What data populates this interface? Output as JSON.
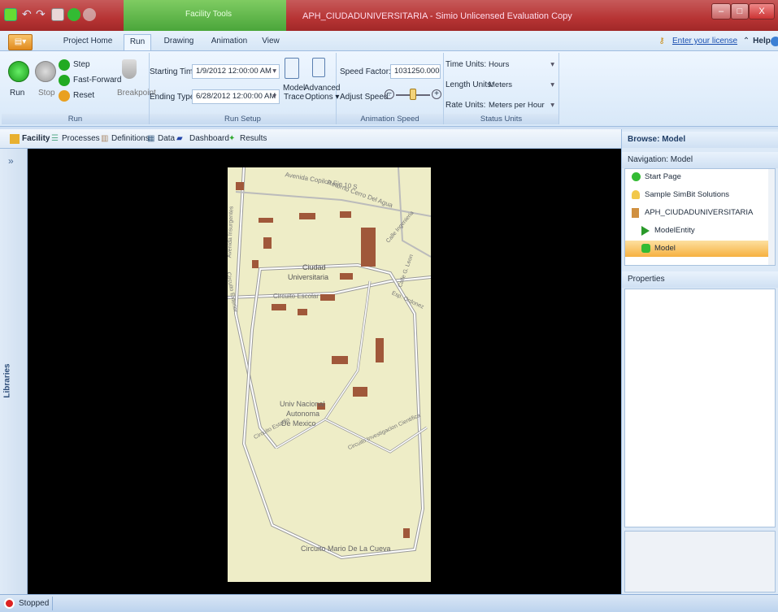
{
  "window": {
    "title": "APH_CIUDADUNIVERSITARIA - Simio Unlicensed Evaluation Copy",
    "context_tab": "Facility Tools"
  },
  "ribbon_tabs": [
    "Project Home",
    "Run",
    "Drawing",
    "Animation",
    "View"
  ],
  "license_link": "Enter your license key...",
  "help_label": "Help",
  "run_group": {
    "run": "Run",
    "stop": "Stop",
    "step": "Step",
    "fast_forward": "Fast-Forward",
    "reset": "Reset",
    "breakpoint": "Breakpoint",
    "label": "Run"
  },
  "run_setup": {
    "starting_time_label": "Starting Time:",
    "starting_time": "1/9/2012 12:00:00 AM",
    "ending_type_label": "Ending Type:",
    "ending_type": "6/28/2012 12:00:00 AM",
    "model_trace_1": "Model",
    "model_trace_2": "Trace",
    "advanced_1": "Advanced",
    "advanced_2": "Options ▾",
    "label": "Run Setup"
  },
  "animation_speed": {
    "speed_factor_label": "Speed Factor:",
    "speed_factor": "1031250.000",
    "adjust_speed_label": "Adjust Speed:",
    "adjust_speed_level": 0.5,
    "label": "Animation Speed"
  },
  "status_units": {
    "time_units_label": "Time Units:",
    "time_units": "Hours",
    "length_units_label": "Length Units:",
    "length_units": "Meters",
    "rate_units_label": "Rate Units:",
    "rate_units": "Meters per Hour",
    "label": "Status Units"
  },
  "view_tabs": [
    "Facility",
    "Processes",
    "Definitions",
    "Data",
    "Dashboard",
    "Results"
  ],
  "libraries_label": "Libraries",
  "map_labels": {
    "copilco": "Avenida Copilco Eje 10 S",
    "retorno": "Retorno Cerro Del Agua",
    "ingenieria": "Calle Ingenieria",
    "insurgentes": "Avenida Insurgentes",
    "ciudad": "Ciudad",
    "universitaria": "Universitaria",
    "escolar": "Circuito Escolar",
    "exterior": "Circuito Exterior",
    "leon": "Calle G. Leon",
    "ordonez": "Esp. Ordonez",
    "unam1": "Univ Nacional",
    "unam2": "Autonoma",
    "unam3": "De Mexico",
    "estadio": "Circuito Estadio",
    "investigacion": "Circuito Investigacion Cientifica",
    "cueva": "Circuito Mario De La Cueva"
  },
  "browse": {
    "title": "Browse: Model",
    "navigation_title": "Navigation: Model",
    "items": [
      "Start Page",
      "Sample SimBit Solutions",
      "APH_CIUDADUNIVERSITARIA",
      "ModelEntity",
      "Model"
    ],
    "properties_title": "Properties"
  },
  "status_bar": {
    "state": "Stopped"
  },
  "colors": {
    "title_bar": "#b73434",
    "context_tab": "#4aa63a",
    "selected_item": "#f6b040",
    "canvas": "#000000",
    "map_bg": "#eeedc7",
    "building": "#a0583a"
  }
}
